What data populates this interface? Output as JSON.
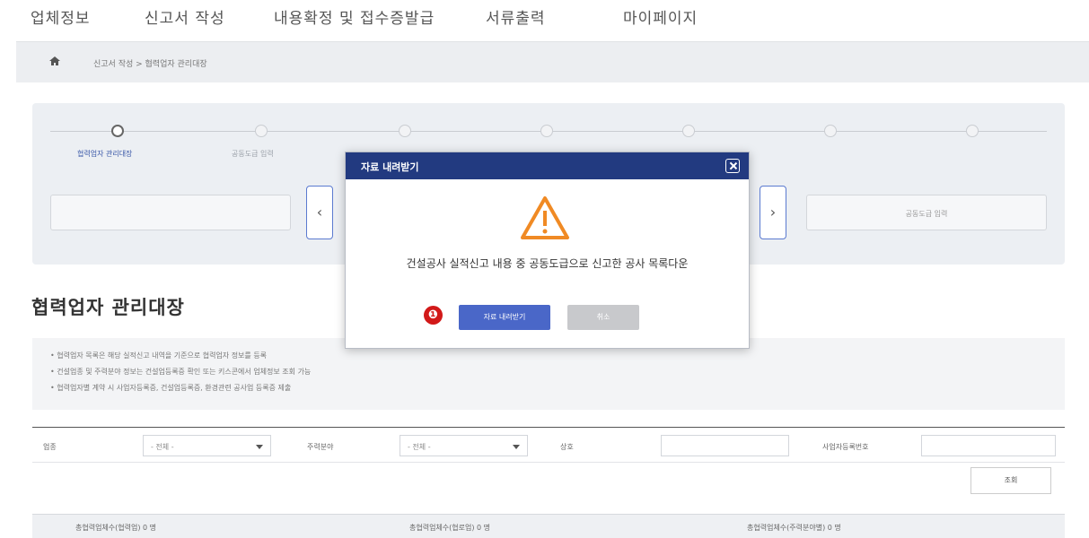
{
  "top_nav": [
    "업체정보",
    "신고서 작성",
    "내용확정 및 접수증발급",
    "서류출력",
    "마이페이지"
  ],
  "breadcrumb": "신고서 작성  >  협력업자 관리대장",
  "steps": [
    "협력업자 관리대장",
    "공동도급 입력",
    "",
    "",
    "",
    "",
    "",
    ""
  ],
  "step_fields": {
    "right_box": "공동도급 입력"
  },
  "page_heading": "협력업자 관리대장",
  "notes": [
    "• 협력업자 목록은 해당 실적신고 내역을 기준으로 협력업자 정보를 등록",
    "• 건설업종 및 주력분야 정보는 건설업등록증 확인 또는 키스콘에서 업체정보 조회 가능",
    "• 협력업자별 계약 시 사업자등록증, 건설업등록증, 환경관련 공사업 등록증 제출"
  ],
  "filters": {
    "label1": "업종",
    "select1": "- 전체 -",
    "label2": "주력분야",
    "select2": "- 전체 -",
    "label3": "상호",
    "label4": "사업자등록번호",
    "search_btn": "조회"
  },
  "summary": [
    "총협력업체수(협력업) 0 명",
    "총협력업체수(협로업) 0 명",
    "총협력업체수(주력분야별) 0 명"
  ],
  "modal": {
    "title": "자료 내려받기",
    "message": "건설공사 실적신고 내용 중 공동도급으로 신고한 공사 목록다운",
    "primary_btn": "자료 내려받기",
    "cancel_btn": "취소"
  },
  "marker": "❶",
  "colors": {
    "modal_header": "#223a80",
    "primary": "#4a67c8",
    "warning": "#f08a24",
    "marker": "#d21919"
  }
}
